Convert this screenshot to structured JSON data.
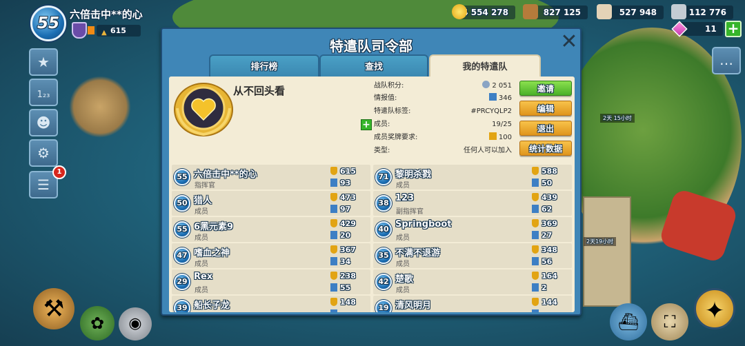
{
  "player": {
    "level": "55",
    "name": "六倍击中**的心",
    "trophies": "615"
  },
  "resources": {
    "gold": "4 554 278",
    "wood": "827 125",
    "stone": "527 948",
    "iron": "112 776",
    "gems": "11"
  },
  "side_buttons": {
    "notification_count": "1"
  },
  "panel": {
    "title": "特遣队司令部",
    "tabs": [
      {
        "label": "排行榜"
      },
      {
        "label": "查找"
      },
      {
        "label": "我的特遣队"
      }
    ],
    "task_force": {
      "name": "从不回头看",
      "rows": [
        {
          "label": "战队积分:",
          "value": "2 051"
        },
        {
          "label": "情报值:",
          "value": "346"
        },
        {
          "label": "特遣队标签:",
          "value": "#PRCYQLP2"
        },
        {
          "label": "成员:",
          "value": "19/25"
        },
        {
          "label": "成员奖牌要求:",
          "value": "100"
        },
        {
          "label": "类型:",
          "value": "任何人可以加入"
        }
      ]
    },
    "buttons": {
      "invite": "邀请",
      "edit": "编辑",
      "leave": "退出",
      "stats": "统计数据"
    },
    "members": [
      {
        "level": "55",
        "name": "六倍击中**的心",
        "role": "指挥官",
        "medals": "615",
        "intel": "93"
      },
      {
        "level": "71",
        "name": "黎明杀戮",
        "role": "成员",
        "medals": "588",
        "intel": "50"
      },
      {
        "level": "50",
        "name": "猎人",
        "role": "成员",
        "medals": "473",
        "intel": "97"
      },
      {
        "level": "38",
        "name": "123",
        "role": "副指挥官",
        "medals": "439",
        "intel": "62"
      },
      {
        "level": "55",
        "name": "6黑元素9",
        "role": "成员",
        "medals": "429",
        "intel": "20"
      },
      {
        "level": "40",
        "name": "Springboot",
        "role": "成员",
        "medals": "369",
        "intel": "27"
      },
      {
        "level": "47",
        "name": "嗜血之神",
        "role": "成员",
        "medals": "367",
        "intel": "34"
      },
      {
        "level": "35",
        "name": "不满不退游",
        "role": "成员",
        "medals": "348",
        "intel": "56"
      },
      {
        "level": "29",
        "name": "Rex",
        "role": "成员",
        "medals": "238",
        "intel": "55"
      },
      {
        "level": "42",
        "name": "楚歌",
        "role": "成员",
        "medals": "164",
        "intel": "2"
      },
      {
        "level": "39",
        "name": "船长子龙",
        "role": "",
        "medals": "148",
        "intel": ""
      },
      {
        "level": "19",
        "name": "清风明月",
        "role": "",
        "medals": "144",
        "intel": ""
      }
    ]
  },
  "map_labels": {
    "label_a": "2天 15小时",
    "label_b": "2天19小时"
  },
  "colors": {
    "panel_blue": "#3f86b7",
    "parchment": "#f3ecd6",
    "gold_button": "#df951c",
    "green_button": "#49b028"
  }
}
